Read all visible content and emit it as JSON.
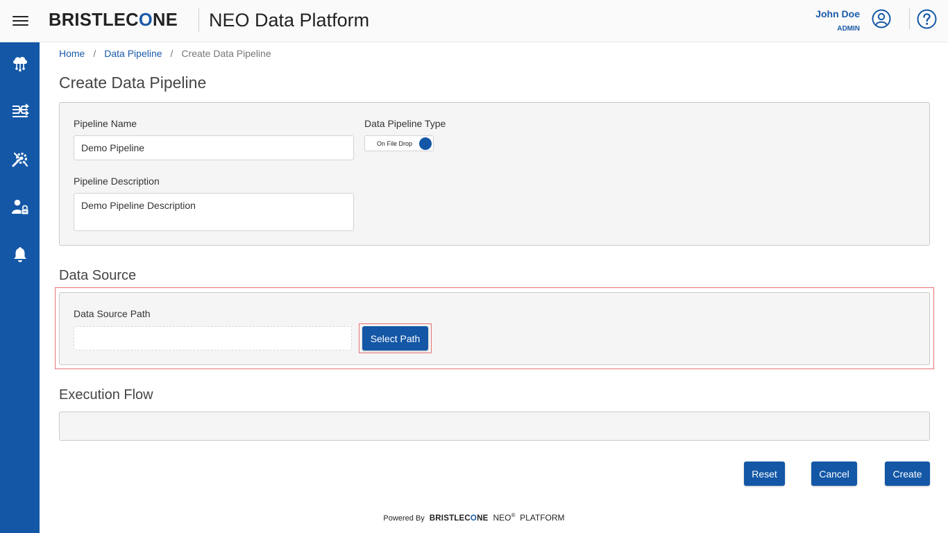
{
  "header": {
    "brand_prefix": "BRISTLEC",
    "brand_o": "O",
    "brand_suffix": "NE",
    "app_title": "NEO Data Platform",
    "user_name": "John Doe",
    "user_role": "ADMIN"
  },
  "sidebar": {
    "items": [
      {
        "icon": "cloud-network-icon"
      },
      {
        "icon": "pipeline-flow-icon"
      },
      {
        "icon": "tools-gear-icon"
      },
      {
        "icon": "user-lock-icon"
      },
      {
        "icon": "bell-icon"
      }
    ]
  },
  "breadcrumb": {
    "home": "Home",
    "data_pipeline": "Data Pipeline",
    "current": "Create Data Pipeline",
    "separator": "/"
  },
  "page_title": "Create Data Pipeline",
  "form": {
    "pipeline_name_label": "Pipeline Name",
    "pipeline_name_value": "Demo Pipeline",
    "pipeline_type_label": "Data Pipeline Type",
    "pipeline_type_value": "On File Drop",
    "pipeline_description_label": "Pipeline Description",
    "pipeline_description_value": "Demo Pipeline Description"
  },
  "data_source": {
    "section_title": "Data Source",
    "path_label": "Data Source Path",
    "path_value": "",
    "select_path_button": "Select Path"
  },
  "execution_flow": {
    "section_title": "Execution Flow"
  },
  "actions": {
    "reset": "Reset",
    "cancel": "Cancel",
    "create": "Create"
  },
  "footer": {
    "powered_by": "Powered By",
    "brand_prefix": "BRISTLEC",
    "brand_o": "O",
    "brand_suffix": "NE",
    "neo": "NEO",
    "registered": "®",
    "platform": "PLATFORM"
  },
  "colors": {
    "primary": "#1357a6",
    "highlight": "#e57373"
  }
}
